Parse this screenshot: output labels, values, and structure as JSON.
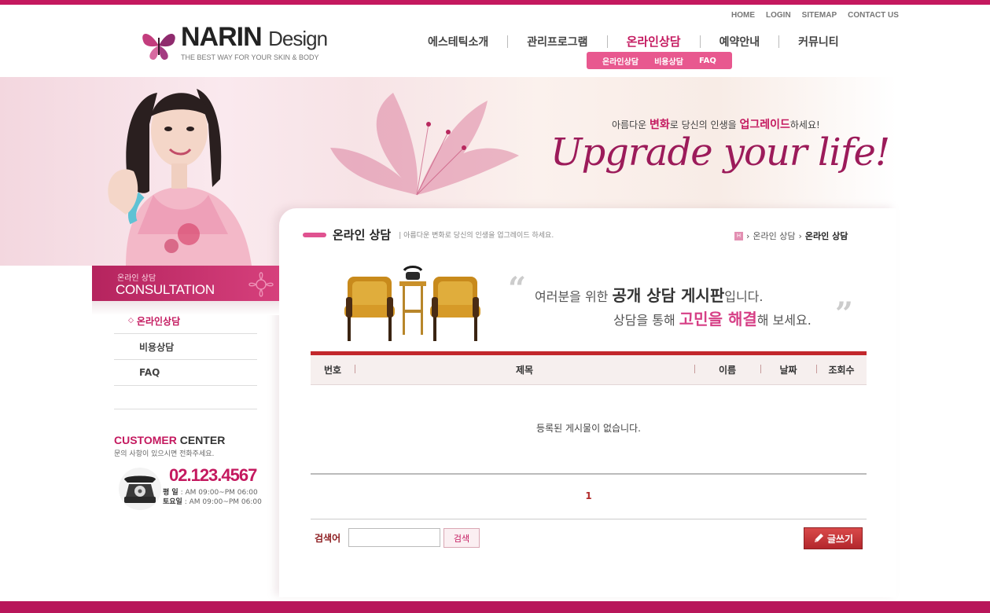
{
  "util_nav": [
    "HOME",
    "LOGIN",
    "SITEMAP",
    "CONTACT US"
  ],
  "logo": {
    "brand": "NARIN",
    "brand_suffix": "Design",
    "tagline": "THE BEST WAY FOR YOUR  SKIN & BODY"
  },
  "main_nav": [
    {
      "label": "에스테틱소개"
    },
    {
      "label": "관리프로그램"
    },
    {
      "label": "온라인상담"
    },
    {
      "label": "예약안내"
    },
    {
      "label": "커뮤니티"
    }
  ],
  "sub_nav": [
    "온라인상담",
    "비용상담",
    "FAQ"
  ],
  "hero": {
    "slogan_parts": [
      "아름다운 ",
      "변화",
      "로 당신의 인생을 ",
      "업그레이드",
      "하세요!"
    ],
    "headline": "Upgrade your life!"
  },
  "side": {
    "head_small": "온라인 상담",
    "head_big": "CONSULTATION",
    "menu": [
      "온라인상담",
      "비용상담",
      "FAQ"
    ]
  },
  "customer_center": {
    "title_pink": "CUSTOMER",
    "title_rest": " CENTER",
    "desc": "문의 사항이 있으시면 전화주세요.",
    "phone": "02.123.4567",
    "weekday_label": "평    일",
    "weekday_hours": " : AM 09:00~PM 06:00",
    "saturday_label": "토요일",
    "saturday_hours": " : AM 09:00~PM 06:00"
  },
  "page": {
    "title": "온라인 상담",
    "subtitle": "| 아름다운 변화로 당신의 인생을 업그레이드 하세요.",
    "breadcrumb": [
      "온라인 상담",
      "온라인 상담"
    ],
    "home_icon_text": "H"
  },
  "intro": {
    "line1_a": "여러분을 위한 ",
    "line1_b": "공개 상담 게시판",
    "line1_c": "입니다.",
    "line2_a": "상담을 통해  ",
    "line2_b": "고민을 해결",
    "line2_c": "해 보세요."
  },
  "board": {
    "columns": [
      "번호",
      "제목",
      "이름",
      "날짜",
      "조회수"
    ],
    "empty_message": "등록된 게시물이 없습니다.",
    "page": "1"
  },
  "search": {
    "label": "검색어",
    "button": "검색",
    "placeholder": ""
  },
  "write_button": "글쓰기",
  "colors": {
    "accent": "#c4195f",
    "board_top": "#c2272c"
  }
}
